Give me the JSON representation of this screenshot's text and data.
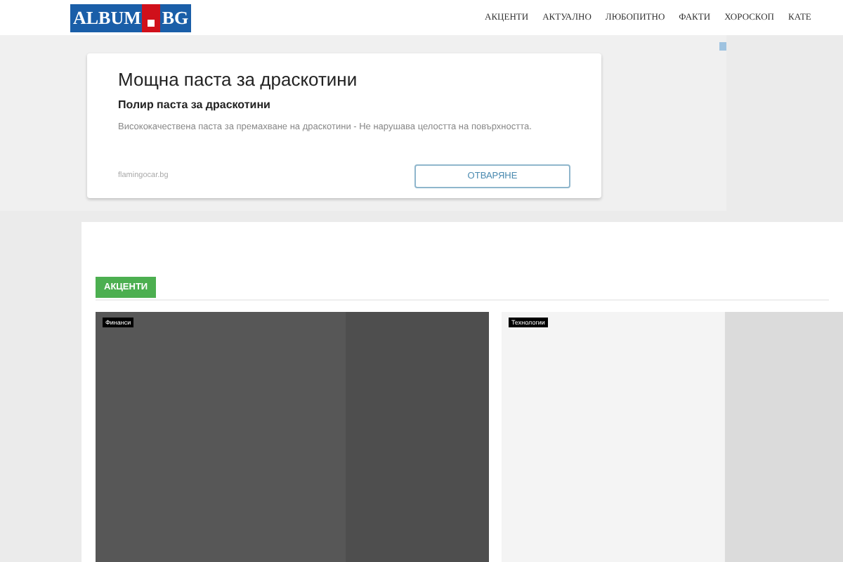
{
  "header": {
    "logo": {
      "left": "ALBUM",
      "right": "BG"
    },
    "nav": [
      {
        "label": "АКЦЕНТИ"
      },
      {
        "label": "АКТУАЛНО"
      },
      {
        "label": "ЛЮБОПИТНО"
      },
      {
        "label": "ФАКТИ"
      },
      {
        "label": "ХОРОСКОП"
      },
      {
        "label": "КАТЕ"
      }
    ]
  },
  "ad": {
    "title": "Мощна паста за драскотини",
    "subtitle": "Полир паста за драскотини",
    "description": "Висококачествена паста за премахване на драскотини - Не нарушава целостта на повърхността.",
    "domain": "flamingocar.bg",
    "button": "ОТВАРЯНЕ"
  },
  "section": {
    "tabs": [
      {
        "label": "АКЦЕНТИ",
        "selected": true
      }
    ],
    "cards": [
      {
        "category": "Финанси",
        "kind": "dark"
      },
      {
        "category": "Технологии",
        "kind": "light"
      }
    ]
  }
}
